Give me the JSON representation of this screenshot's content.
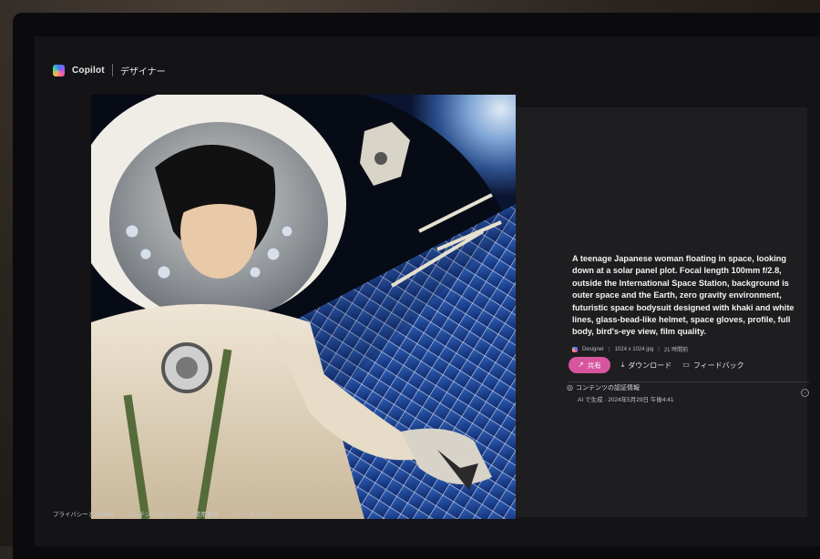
{
  "header": {
    "brand": "Copilot",
    "section": "デザイナー"
  },
  "image": {
    "description_icon": "generated-image"
  },
  "panel": {
    "prompt": "A teenage Japanese woman floating in space, looking down at a solar panel plot. Focal length 100mm f/2.8, outside the International Space Station, background is outer space and the Earth, zero gravity environment, futuristic space bodysuit designed with khaki and white lines, glass-bead-like helmet, space gloves, profile, full body, bird's-eye view, film quality.",
    "meta": {
      "source": "Designer",
      "dimensions": "1024 x 1024 jpg",
      "age": "21 時間前"
    },
    "actions": {
      "share": "共有",
      "download": "ダウンロード",
      "feedback": "フィードバック"
    },
    "credentials": {
      "title": "コンテンツの認証情報",
      "subtitle": "AI で生成 · 2024年5月29日 午後4:41"
    }
  },
  "footer": {
    "links": [
      "プライバシーと Cookie",
      "コンテンツ ポリシー",
      "使用条件",
      "フィードバック"
    ]
  },
  "colors": {
    "accent": "#d7559e",
    "panel": "#1e1e21",
    "screen": "#141416"
  }
}
